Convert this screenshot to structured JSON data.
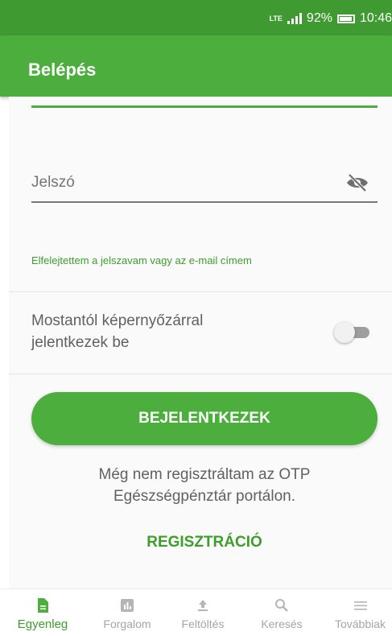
{
  "status_bar": {
    "network": "LTE",
    "battery": "92%",
    "time": "10:46"
  },
  "app_bar": {
    "title": "Belépés"
  },
  "form": {
    "password_placeholder": "Jelszó",
    "forgot_link": "Elfelejtettem a jelszavam vagy az e-mail címem",
    "screenlock_label_line1": "Mostantól képernyőzárral",
    "screenlock_label_line2": "jelentkezek be",
    "screenlock_enabled": false,
    "login_button": "BEJELENTKEZEK",
    "register_text_line1": "Még nem regisztráltam az OTP",
    "register_text_line2": "Egészségpénztár portálon.",
    "register_link": "REGISZTRÁCIÓ"
  },
  "bottom_nav": {
    "items": [
      {
        "label": "Egyenleg",
        "icon": "document-icon",
        "active": true
      },
      {
        "label": "Forgalom",
        "icon": "chart-icon",
        "active": false
      },
      {
        "label": "Feltöltés",
        "icon": "upload-icon",
        "active": false
      },
      {
        "label": "Keresés",
        "icon": "search-icon",
        "active": false
      },
      {
        "label": "Továbbiak",
        "icon": "menu-icon",
        "active": false
      }
    ]
  },
  "colors": {
    "accent": "#4caf3d",
    "status_bar": "#3f9a32",
    "link": "#3d9e2b"
  }
}
